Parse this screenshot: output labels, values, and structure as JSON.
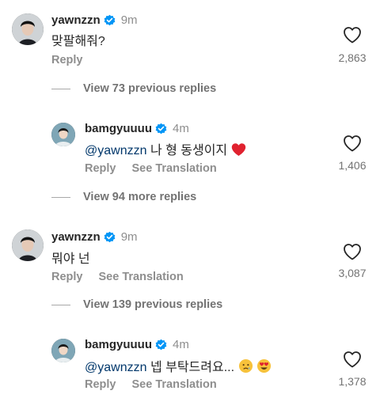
{
  "comments": [
    {
      "username": "yawnzzn",
      "time": "9m",
      "text": "맞팔해줘?",
      "actions": [
        "Reply"
      ],
      "likes": "2,863"
    },
    {
      "username": "bamgyuuuu",
      "time": "4m",
      "mention": "@yawnzzn",
      "text": " 나 형 동생이지",
      "emoji": "heart",
      "actions": [
        "Reply",
        "See Translation"
      ],
      "likes": "1,406"
    },
    {
      "username": "yawnzzn",
      "time": "9m",
      "text": "뭐야 넌",
      "actions": [
        "Reply",
        "See Translation"
      ],
      "likes": "3,087"
    },
    {
      "username": "bamgyuuuu",
      "time": "4m",
      "mention": "@yawnzzn",
      "text": " 넵 부탁드려요...",
      "emoji": "crying-face, heart-eyes-face",
      "actions": [
        "Reply",
        "See Translation"
      ],
      "likes": "1,378"
    }
  ],
  "view_replies": [
    "View 73 previous replies",
    "View 94 more replies",
    "View 139 previous replies"
  ],
  "colors": {
    "verified": "#0095f6",
    "mention": "#00376b",
    "secondary_text": "#8e8e8e"
  }
}
